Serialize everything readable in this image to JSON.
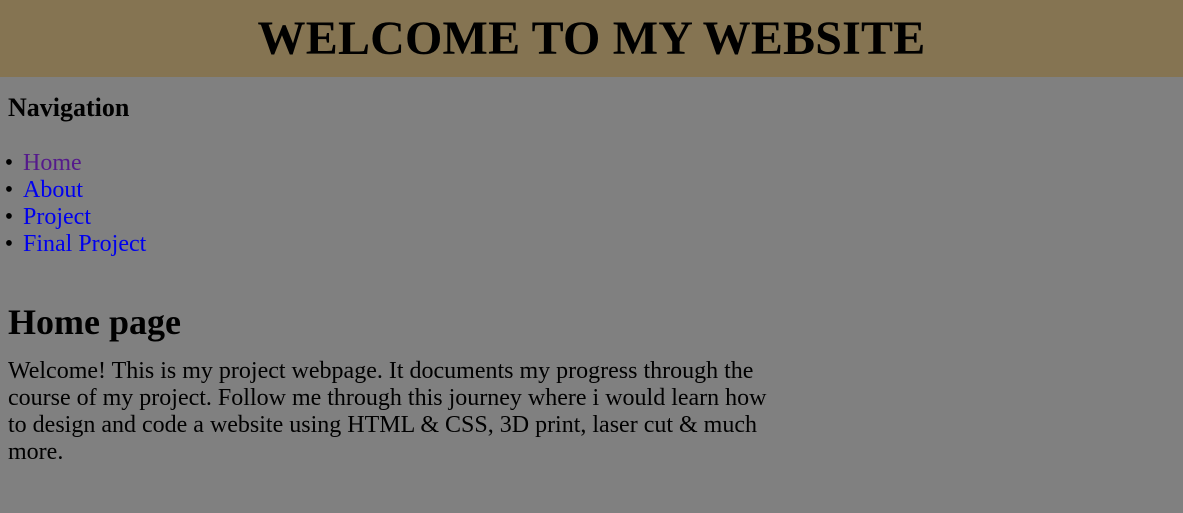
{
  "header": {
    "title": "WELCOME TO MY WEBSITE"
  },
  "navigation": {
    "heading": "Navigation",
    "items": [
      {
        "label": "Home",
        "state": "visited"
      },
      {
        "label": "About",
        "state": "link"
      },
      {
        "label": "Project",
        "state": "link"
      },
      {
        "label": "Final Project",
        "state": "link"
      }
    ]
  },
  "main": {
    "heading": "Home page",
    "paragraph": "Welcome! This is my project webpage. It documents my progress through the course of my project. Follow me through this journey where i would learn how to design and code a website using HTML & CSS, 3D print, laser cut & much more."
  },
  "colors": {
    "header_background": "#857452",
    "page_background": "#808080",
    "link": "#0000ee",
    "visited_link": "#551a8b"
  }
}
